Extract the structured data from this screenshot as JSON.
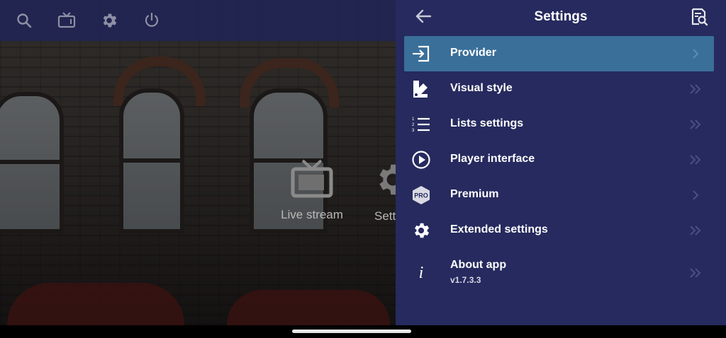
{
  "topbar": {
    "icons": [
      "search-icon",
      "tv-icon",
      "gear-icon",
      "power-icon"
    ]
  },
  "home": {
    "tiles": [
      {
        "label": "Live stream",
        "icon": "tv-icon"
      },
      {
        "label": "Setti",
        "icon": "gear-icon"
      }
    ]
  },
  "settings": {
    "title": "Settings",
    "back_icon": "arrow-left-icon",
    "search_icon": "document-search-icon",
    "items": [
      {
        "label": "Provider",
        "icon": "login-icon",
        "active": true
      },
      {
        "label": "Visual style",
        "icon": "palette-icon"
      },
      {
        "label": "Lists settings",
        "icon": "numbered-list-icon"
      },
      {
        "label": "Player interface",
        "icon": "play-circle-icon"
      },
      {
        "label": "Premium",
        "icon": "pro-badge-icon",
        "badge": "PRO"
      },
      {
        "label": "Extended settings",
        "icon": "gear-icon"
      },
      {
        "label": "About app",
        "icon": "info-icon",
        "sublabel": "v1.7.3.3"
      }
    ]
  },
  "colors": {
    "panel_bg": "#262a5e",
    "active_item": "#3a6f99",
    "topbar_bg": "#202454"
  }
}
